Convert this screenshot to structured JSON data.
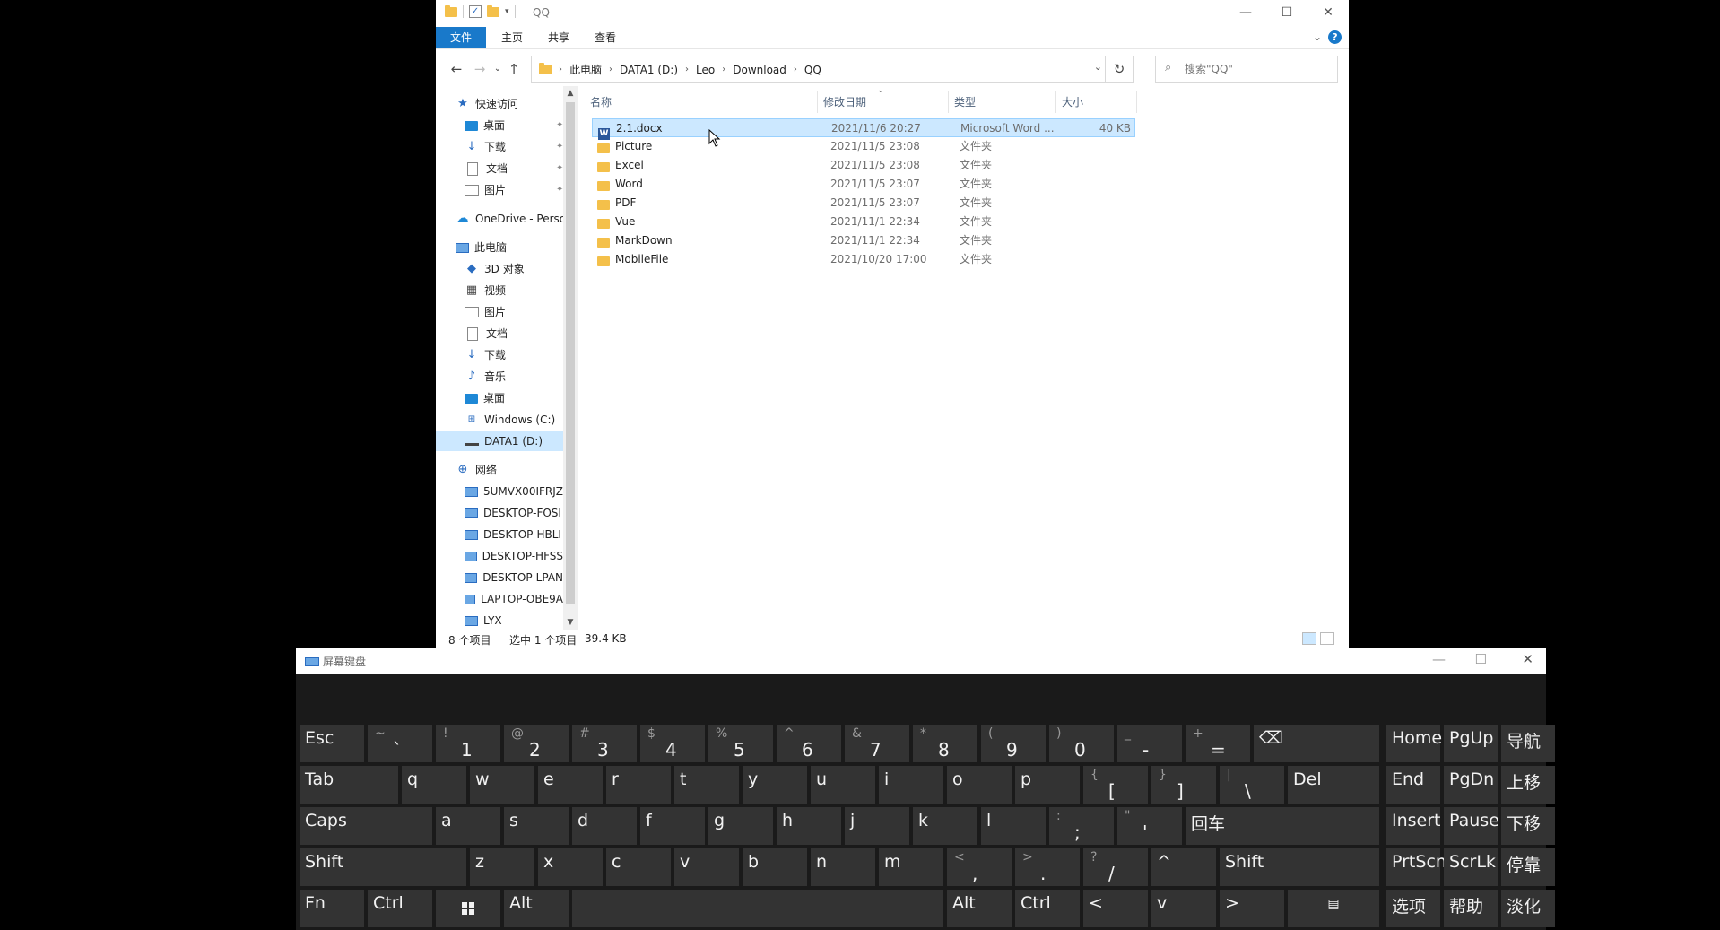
{
  "explorer": {
    "title": "QQ",
    "ribbon_tabs": [
      "文件",
      "主页",
      "共享",
      "查看"
    ],
    "help_label": "?",
    "breadcrumb": [
      "此电脑",
      "DATA1 (D:)",
      "Leo",
      "Download",
      "QQ"
    ],
    "search_placeholder": "搜索\"QQ\"",
    "nav": {
      "quick_access": "快速访问",
      "quick_items": [
        "桌面",
        "下载",
        "文档",
        "图片"
      ],
      "onedrive": "OneDrive - Perso",
      "this_pc": "此电脑",
      "pc_items": [
        "3D 对象",
        "视频",
        "图片",
        "文档",
        "下载",
        "音乐",
        "桌面",
        "Windows (C:)",
        "DATA1 (D:)"
      ],
      "network": "网络",
      "network_items": [
        "5UMVX00IFRJZ",
        "DESKTOP-FOSI",
        "DESKTOP-HBLI",
        "DESKTOP-HFSS",
        "DESKTOP-LPAN",
        "LAPTOP-OBE9A",
        "LYX"
      ]
    },
    "columns": {
      "name": "名称",
      "date": "修改日期",
      "type": "类型",
      "size": "大小"
    },
    "files": [
      {
        "name": "2.1.docx",
        "date": "2021/11/6 20:27",
        "type": "Microsoft Word ...",
        "size": "40 KB",
        "icon": "word-icon"
      },
      {
        "name": "Picture",
        "date": "2021/11/5 23:08",
        "type": "文件夹",
        "size": "",
        "icon": "folder-icon"
      },
      {
        "name": "Excel",
        "date": "2021/11/5 23:08",
        "type": "文件夹",
        "size": "",
        "icon": "folder-icon"
      },
      {
        "name": "Word",
        "date": "2021/11/5 23:07",
        "type": "文件夹",
        "size": "",
        "icon": "folder-icon"
      },
      {
        "name": "PDF",
        "date": "2021/11/5 23:07",
        "type": "文件夹",
        "size": "",
        "icon": "folder-icon"
      },
      {
        "name": "Vue",
        "date": "2021/11/1 22:34",
        "type": "文件夹",
        "size": "",
        "icon": "folder-icon"
      },
      {
        "name": "MarkDown",
        "date": "2021/11/1 22:34",
        "type": "文件夹",
        "size": "",
        "icon": "folder-icon"
      },
      {
        "name": "MobileFile",
        "date": "2021/10/20 17:00",
        "type": "文件夹",
        "size": "",
        "icon": "folder-icon"
      }
    ],
    "status": {
      "count": "8 个项目",
      "selected": "选中 1 个项目",
      "size": "39.4 KB"
    }
  },
  "osk": {
    "title": "屏幕键盘",
    "rows": {
      "r1": [
        {
          "top": "",
          "main": "Esc"
        },
        {
          "top": "~",
          "main": "`"
        },
        {
          "top": "!",
          "main": "1"
        },
        {
          "top": "@",
          "main": "2"
        },
        {
          "top": "#",
          "main": "3"
        },
        {
          "top": "$",
          "main": "4"
        },
        {
          "top": "%",
          "main": "5"
        },
        {
          "top": "^",
          "main": "6"
        },
        {
          "top": "&",
          "main": "7"
        },
        {
          "top": "*",
          "main": "8"
        },
        {
          "top": "(",
          "main": "9"
        },
        {
          "top": ")",
          "main": "0"
        },
        {
          "top": "_",
          "main": "-"
        },
        {
          "top": "+",
          "main": "="
        },
        {
          "top": "",
          "main": "⌫"
        }
      ],
      "r2": [
        "Tab",
        "q",
        "w",
        "e",
        "r",
        "t",
        "y",
        "u",
        "i",
        "o",
        "p",
        {
          "top": "{",
          "main": "["
        },
        {
          "top": "}",
          "main": "]"
        },
        {
          "top": "|",
          "main": "\\"
        },
        "Del"
      ],
      "r3": [
        "Caps",
        "a",
        "s",
        "d",
        "f",
        "g",
        "h",
        "j",
        "k",
        "l",
        {
          "top": ":",
          "main": ";"
        },
        {
          "top": "\"",
          "main": "'"
        },
        "回车"
      ],
      "r4": [
        "Shift",
        "z",
        "x",
        "c",
        "v",
        "b",
        "n",
        "m",
        {
          "top": "<",
          "main": ","
        },
        {
          "top": ">",
          "main": "."
        },
        {
          "top": "?",
          "main": "/"
        },
        "^",
        "Shift"
      ],
      "r5": [
        "Fn",
        "Ctrl",
        "",
        "Alt",
        "",
        "Alt",
        "Ctrl",
        "<",
        "v",
        ">",
        ""
      ]
    },
    "nav_keys": [
      [
        "Home",
        "PgUp",
        "导航"
      ],
      [
        "End",
        "PgDn",
        "上移"
      ],
      [
        "Insert",
        "Pause",
        "下移"
      ],
      [
        "PrtScn",
        "ScrLk",
        "停靠"
      ],
      [
        "选项",
        "帮助",
        "淡化"
      ]
    ]
  }
}
